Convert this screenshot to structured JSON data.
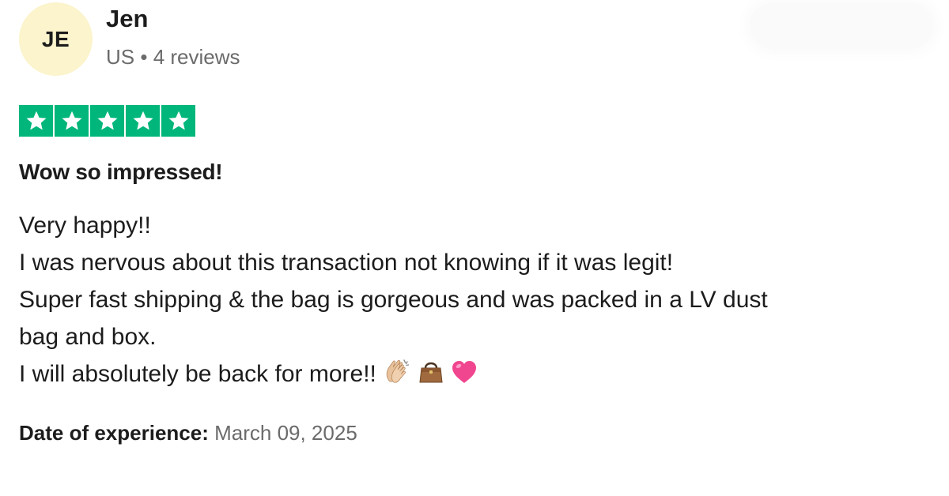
{
  "reviewer": {
    "initials": "JE",
    "name": "Jen",
    "country": "US",
    "separator": "•",
    "review_count": "4 reviews",
    "avatar_color": "#fbf4cc"
  },
  "rating": {
    "stars": 5,
    "max": 5,
    "star_color": "#00b67a"
  },
  "review": {
    "title": "Wow so impressed!",
    "lines": [
      "Very happy!!",
      "I was nervous about this transaction not knowing if it was legit!",
      "Super fast shipping & the bag is gorgeous and was packed in a LV dust",
      "bag and box.",
      "I will absolutely be back for more!!"
    ],
    "emojis": [
      "clapping-hands-icon",
      "handbag-icon",
      "pink-heart-icon"
    ]
  },
  "experience": {
    "label": "Date of experience:",
    "date": "March 09, 2025"
  }
}
